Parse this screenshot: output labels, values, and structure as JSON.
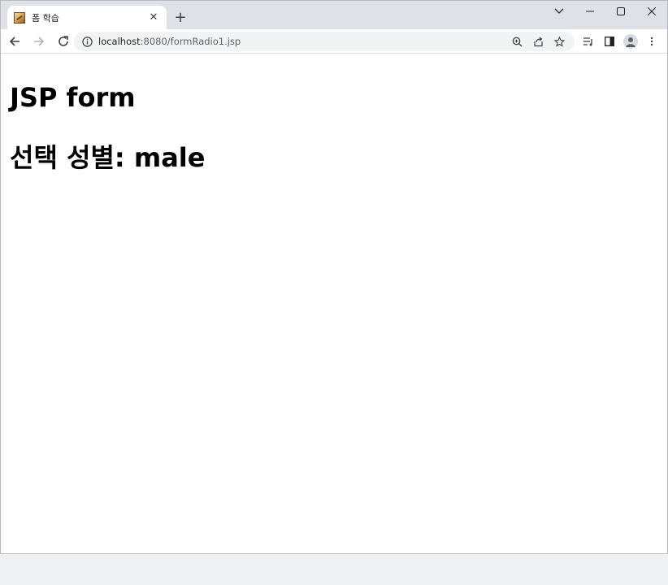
{
  "browser": {
    "tab": {
      "title": "폼 학습",
      "favicon": "image-icon",
      "close_icon": "close-icon"
    },
    "new_tab_icon": "plus-icon",
    "window_controls": [
      "chevron-down-icon",
      "minimize-icon",
      "maximize-icon",
      "close-icon"
    ],
    "address_bar": {
      "host": "localhost",
      "path": ":8080/formRadio1.jsp",
      "info_icon": "info-icon"
    },
    "omnibox_icons": [
      "zoom-icon",
      "share-icon",
      "star-icon"
    ],
    "toolbar_icons": [
      "reading-list-icon",
      "side-panel-icon",
      "profile-icon",
      "more-menu-icon"
    ]
  },
  "page": {
    "title": "JSP form",
    "result_label": "선택 성별: ",
    "result_value": "male"
  },
  "colors": {
    "tabstrip": "#dee1e6",
    "omnibox": "#f1f3f4",
    "text": "#000000"
  }
}
